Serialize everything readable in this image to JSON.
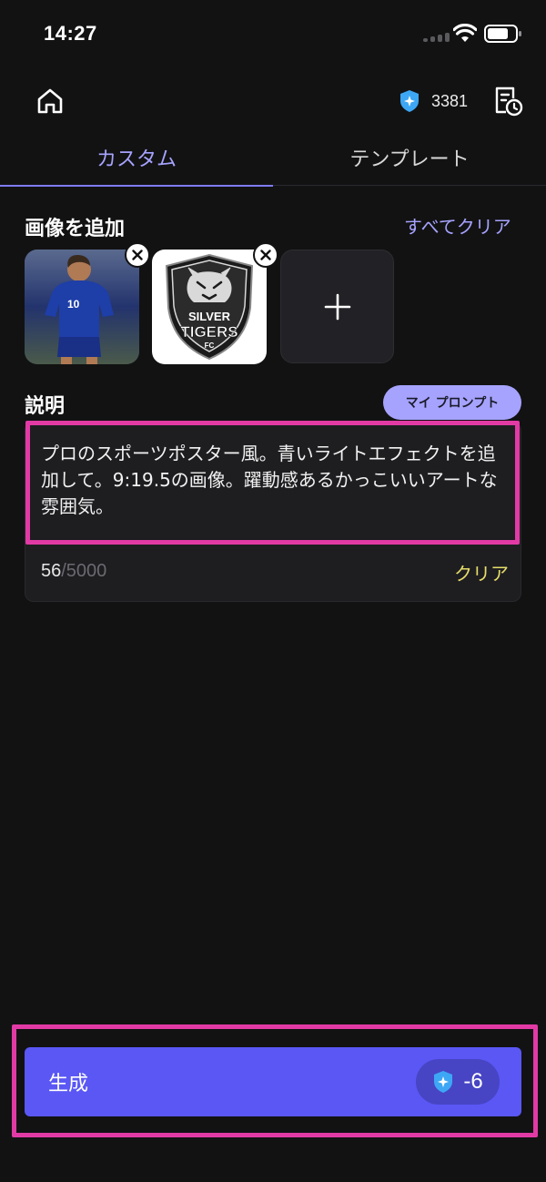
{
  "status_bar": {
    "time": "14:27"
  },
  "header": {
    "credits": "3381"
  },
  "tabs": [
    {
      "label": "カスタム",
      "active": true
    },
    {
      "label": "テンプレート",
      "active": false
    }
  ],
  "images_section": {
    "title": "画像を追加",
    "clear_all_label": "すべてクリア",
    "images": [
      {
        "name": "player-photo",
        "jersey_number": "10"
      },
      {
        "name": "silver-tigers-logo",
        "logo_text_1": "SILVER",
        "logo_text_2": "TIGERS",
        "logo_text_3": "FC"
      }
    ]
  },
  "description_section": {
    "title": "説明",
    "my_prompt_label": "マイ プロンプト",
    "text": "プロのスポーツポスター風。青いライトエフェクトを追加して。9:19.5の画像。躍動感あるかっこいいアートな雰囲気。",
    "char_count": "56",
    "char_max": "/5000",
    "clear_label": "クリア"
  },
  "generate": {
    "label": "生成",
    "cost": "-6"
  },
  "colors": {
    "background": "#121213",
    "accent": "#a6a3ff",
    "button": "#5a57f5",
    "highlight": "#e23aa5",
    "clear_yellow": "#e8de6a"
  }
}
